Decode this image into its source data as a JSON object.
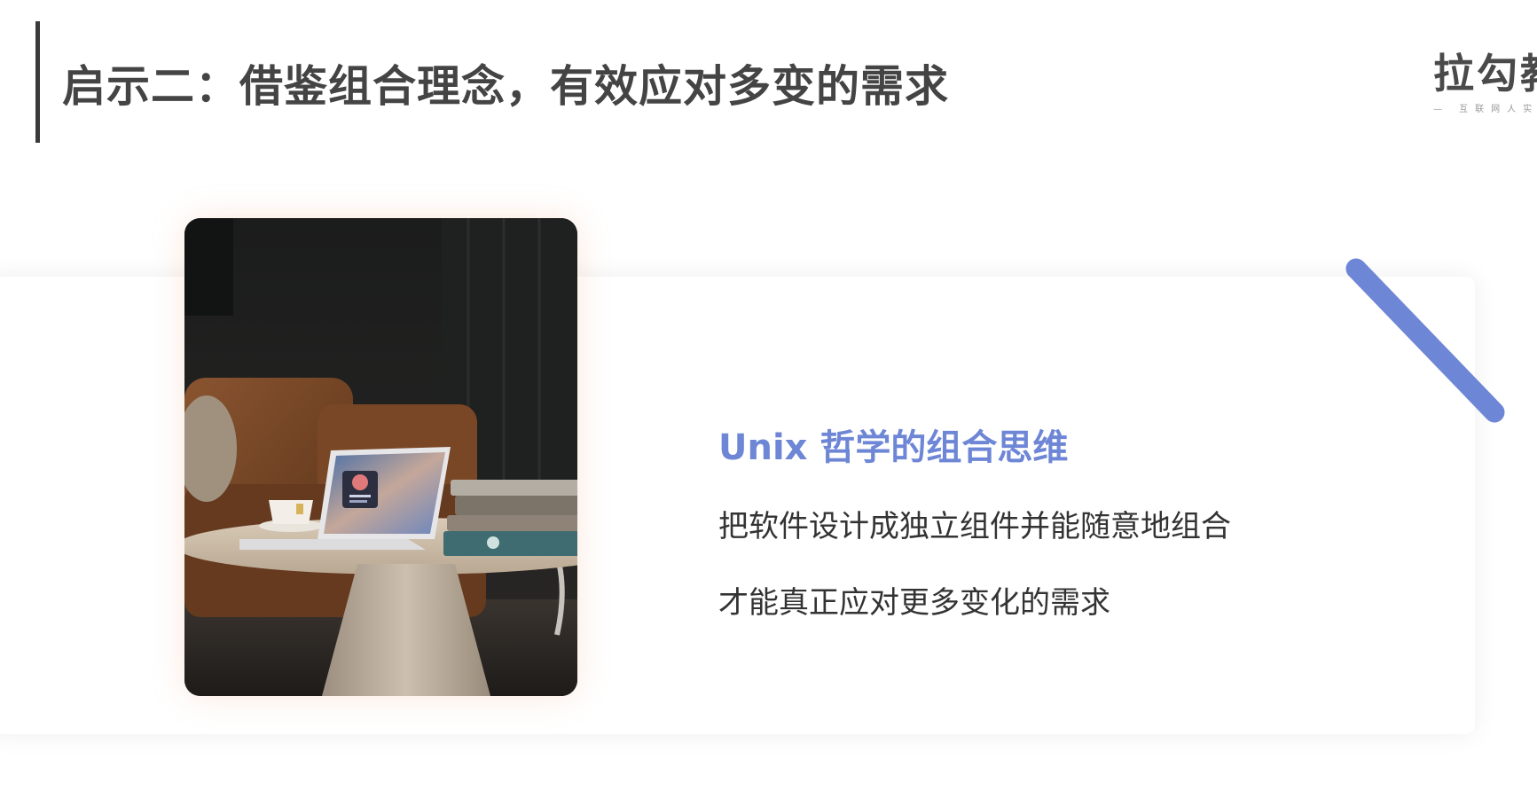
{
  "slide": {
    "title": "启示二：借鉴组合理念，有效应对多变的需求"
  },
  "logo": {
    "main": "拉勾教育",
    "sub": "— 互联网人实战大学 —"
  },
  "card": {
    "heading": "Unix 哲学的组合思维",
    "lines": [
      "把软件设计成独立组件并能随意地组合",
      "才能真正应对更多变化的需求"
    ]
  },
  "colors": {
    "accent": "#6e86d6",
    "title": "#444444",
    "body": "#333333"
  }
}
